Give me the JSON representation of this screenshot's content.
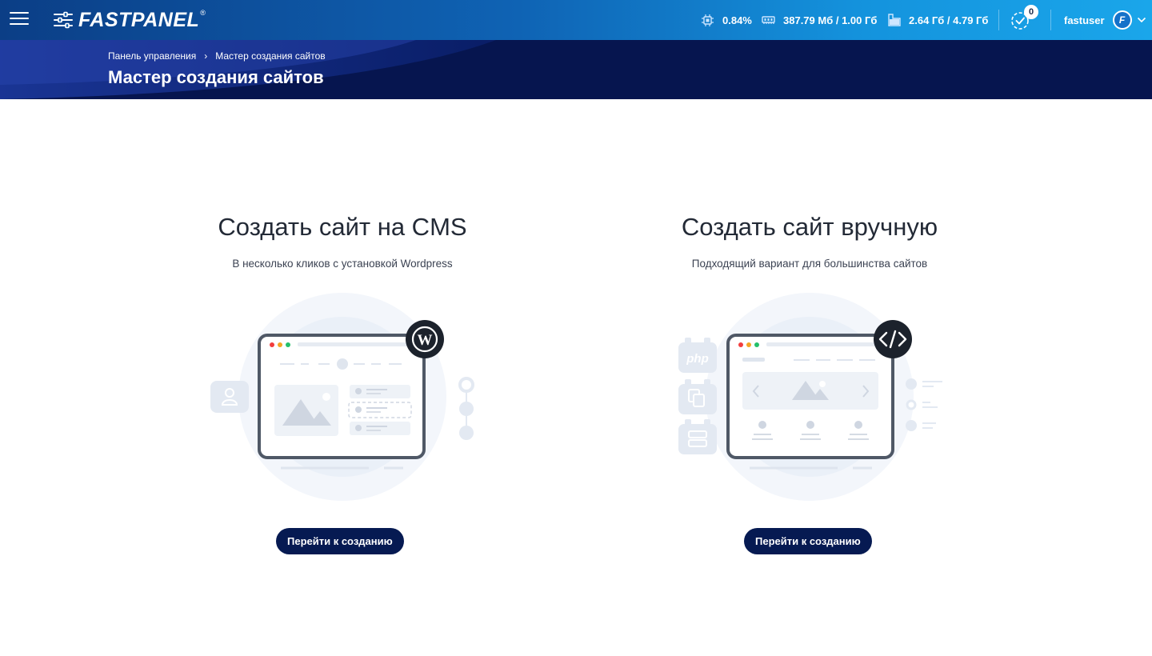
{
  "app": {
    "brand": "FASTPANEL",
    "registered_mark": "®"
  },
  "topbar": {
    "cpu": "0.84%",
    "ram": "387.79 Мб / 1.00 Гб",
    "disk": "2.64 Гб / 4.79 Гб",
    "tasks_count": "0",
    "username": "fastuser",
    "avatar_letter": "F"
  },
  "breadcrumb": {
    "home": "Панель управления",
    "current": "Мастер создания сайтов"
  },
  "page": {
    "title": "Мастер создания сайтов"
  },
  "options": [
    {
      "title": "Создать сайт на CMS",
      "subtitle": "В несколько кликов с установкой Wordpress",
      "button": "Перейти к созданию",
      "badge_icon": "wordpress-icon"
    },
    {
      "title": "Создать сайт вручную",
      "subtitle": "Подходящий вариант для большинства сайтов",
      "button": "Перейти к созданию",
      "badge_icon": "code-icon",
      "side_label": "php"
    }
  ],
  "colors": {
    "topbar_start": "#0b3e86",
    "topbar_end": "#1aa6ea",
    "header_band": "#06154f",
    "button": "#061a52"
  }
}
